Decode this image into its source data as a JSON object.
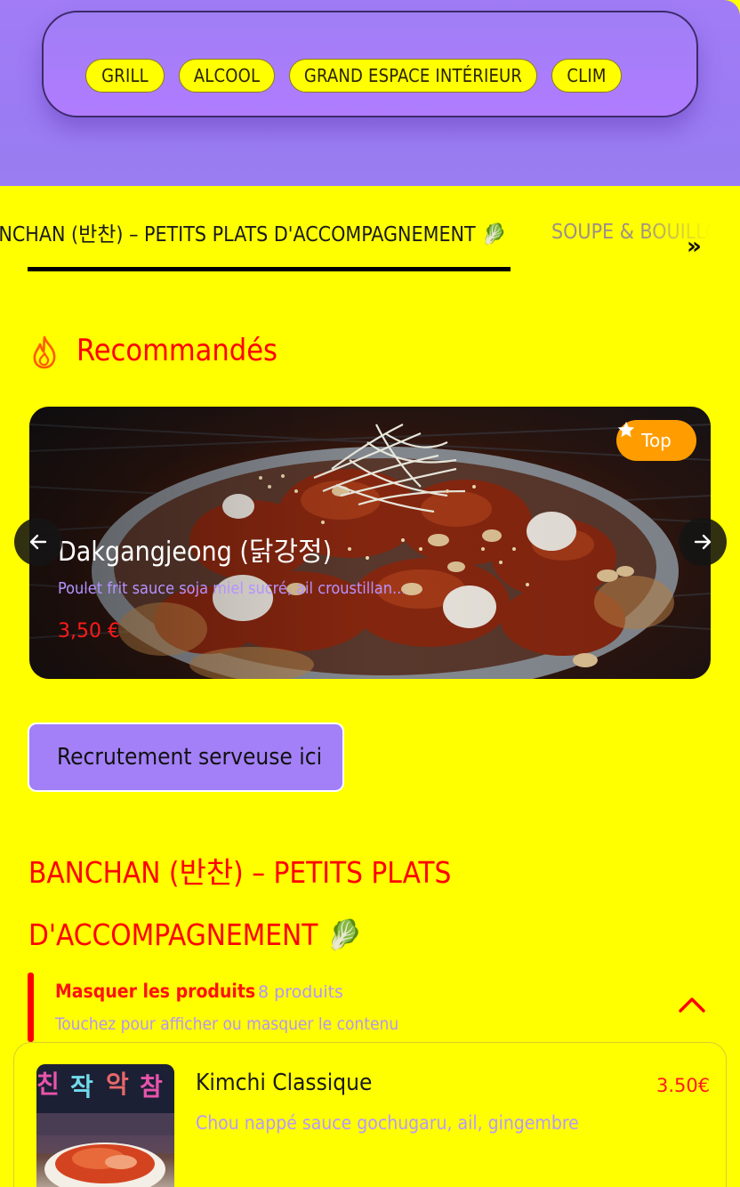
{
  "header": {
    "tags": [
      "GRILL",
      "ALCOOL",
      "GRAND ESPACE INTÉRIEUR",
      "CLIM"
    ]
  },
  "category_tabs": {
    "active_label": "BANCHAN (반찬) – PETITS PLATS D'ACCOMPAGNEMENT 🥬",
    "next_label": "SOUPE & BOUILLON",
    "more_icon": "double-chevron-right-icon"
  },
  "recommended": {
    "icon": "flame-icon",
    "title": "Recommandés",
    "slide": {
      "badge": "Top",
      "badge_icon": "star-icon",
      "title": "Dakgangjeong (닭강정)",
      "description": "Poulet frit sauce soja miel sucré, ail croustillan...",
      "price": "3,50 €"
    },
    "prev_icon": "arrow-left-icon",
    "next_icon": "arrow-right-icon"
  },
  "recruit_button": "Recrutement serveuse ici",
  "section": {
    "title": "BANCHAN (반찬) – PETITS PLATS D'ACCOMPAGNEMENT 🥬",
    "toggle_label": "Masquer les produits",
    "count": "8 produits",
    "hint": "Touchez pour afficher ou masquer le contenu",
    "toggle_icon": "chevron-up-icon"
  },
  "products": [
    {
      "name": "Kimchi Classique",
      "description": "Chou nappé sauce gochugaru, ail, gingembre",
      "price": "3.50€"
    }
  ],
  "colors": {
    "background": "#ffff00",
    "accent_purple": "#a380f7",
    "accent_red": "#ff0000",
    "badge_orange": "#ff9d00"
  }
}
